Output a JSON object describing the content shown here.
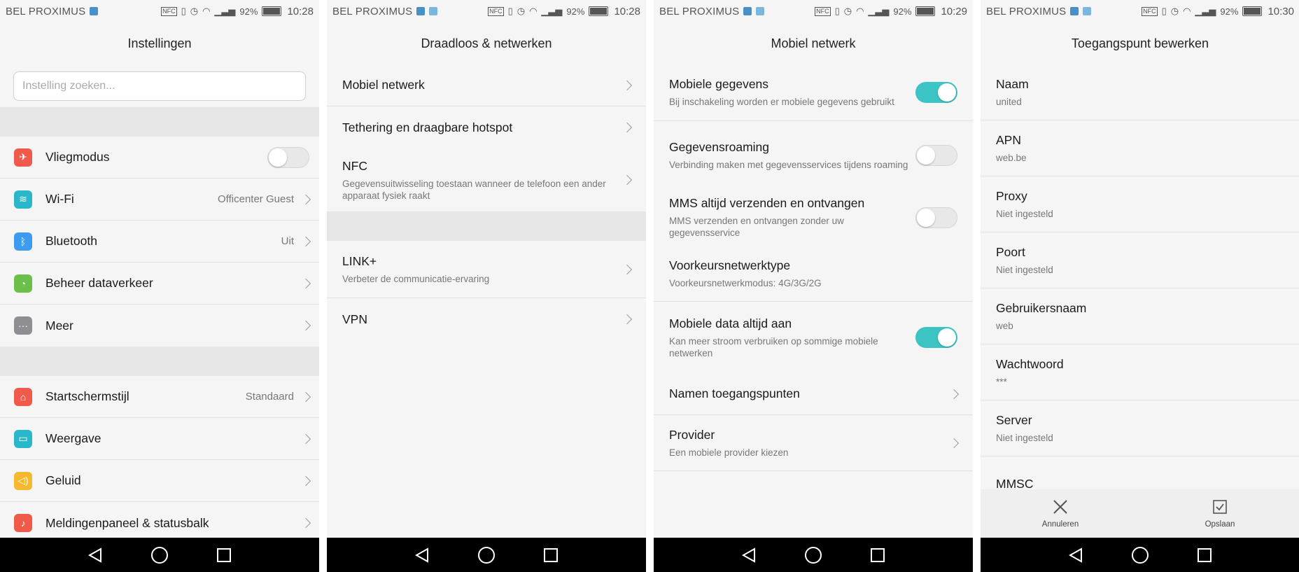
{
  "status_bars": [
    {
      "carrier": "BEL PROXIMUS",
      "nfc": "NFC",
      "battery": "92%",
      "time": "10:28"
    },
    {
      "carrier": "BEL PROXIMUS",
      "nfc": "NFC",
      "battery": "92%",
      "time": "10:28"
    },
    {
      "carrier": "BEL PROXIMUS",
      "nfc": "NFC",
      "battery": "92%",
      "time": "10:29"
    },
    {
      "carrier": "BEL PROXIMUS",
      "nfc": "NFC",
      "battery": "92%",
      "time": "10:30"
    }
  ],
  "screen1": {
    "title": "Instellingen",
    "search_placeholder": "Instelling zoeken...",
    "group1": [
      {
        "label": "Vliegmodus",
        "icon": "airplane-icon",
        "color": "#f05a4a",
        "toggle": "off"
      },
      {
        "label": "Wi-Fi",
        "icon": "wifi-icon",
        "color": "#2ab7c9",
        "value": "Officenter Guest"
      },
      {
        "label": "Bluetooth",
        "icon": "bluetooth-icon",
        "color": "#3d9cf0",
        "value": "Uit"
      },
      {
        "label": "Beheer dataverkeer",
        "icon": "data-usage-icon",
        "color": "#6cc04a"
      },
      {
        "label": "Meer",
        "icon": "more-icon",
        "color": "#8e8e93"
      }
    ],
    "group2": [
      {
        "label": "Startschermstijl",
        "icon": "home-icon",
        "color": "#f05a4a",
        "value": "Standaard"
      },
      {
        "label": "Weergave",
        "icon": "display-icon",
        "color": "#2ab7c9"
      },
      {
        "label": "Geluid",
        "icon": "sound-icon",
        "color": "#f5b82e"
      },
      {
        "label": "Meldingenpaneel & statusbalk",
        "icon": "notification-icon",
        "color": "#f05a4a"
      }
    ]
  },
  "screen2": {
    "title": "Draadloos & netwerken",
    "items1": [
      {
        "title": "Mobiel netwerk",
        "sub": ""
      },
      {
        "title": "Tethering en draagbare hotspot",
        "sub": ""
      },
      {
        "title": "NFC",
        "sub": "Gegevensuitwisseling toestaan wanneer de telefoon een ander apparaat fysiek raakt"
      }
    ],
    "items2": [
      {
        "title": "LINK+",
        "sub": "Verbeter de communicatie-ervaring"
      },
      {
        "title": "VPN",
        "sub": ""
      }
    ]
  },
  "screen3": {
    "title": "Mobiel netwerk",
    "items": [
      {
        "title": "Mobiele gegevens",
        "sub": "Bij inschakeling worden er mobiele gegevens gebruikt",
        "toggle": "on"
      },
      {
        "title": "Gegevensroaming",
        "sub": "Verbinding maken met gegevensservices tijdens roaming",
        "toggle": "off"
      },
      {
        "title": "MMS altijd verzenden en ontvangen",
        "sub": "MMS verzenden en ontvangen zonder uw gegevensservice",
        "toggle": "off"
      },
      {
        "title": "Voorkeursnetwerktype",
        "sub": "Voorkeursnetwerkmodus: 4G/3G/2G"
      },
      {
        "title": "Mobiele data altijd aan",
        "sub": "Kan meer stroom verbruiken op sommige mobiele netwerken",
        "toggle": "on"
      },
      {
        "title": "Namen toegangspunten",
        "sub": "",
        "chevron": true
      },
      {
        "title": "Provider",
        "sub": "Een mobiele provider kiezen",
        "chevron": true
      }
    ]
  },
  "screen4": {
    "title": "Toegangspunt bewerken",
    "fields": [
      {
        "label": "Naam",
        "value": "united"
      },
      {
        "label": "APN",
        "value": "web.be"
      },
      {
        "label": "Proxy",
        "value": "Niet ingesteld"
      },
      {
        "label": "Poort",
        "value": "Niet ingesteld"
      },
      {
        "label": "Gebruikersnaam",
        "value": "web"
      },
      {
        "label": "Wachtwoord",
        "value": "***"
      },
      {
        "label": "Server",
        "value": "Niet ingesteld"
      },
      {
        "label": "MMSC",
        "value": ""
      }
    ],
    "cancel_label": "Annuleren",
    "save_label": "Opslaan"
  }
}
